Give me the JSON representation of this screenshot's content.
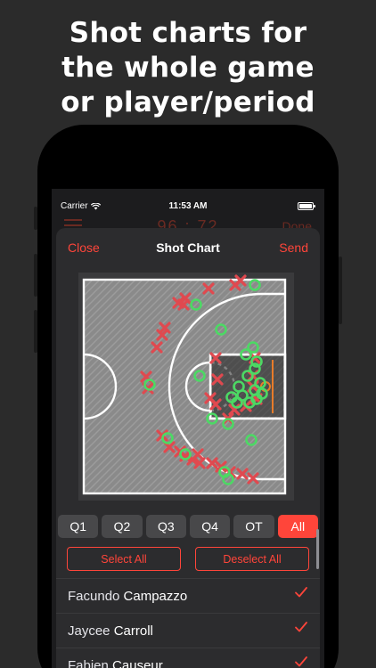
{
  "promo": {
    "line1": "Shot charts for",
    "line2": "the whole game",
    "line3": "or player/period"
  },
  "status_bar": {
    "carrier": "Carrier",
    "time": "11:53 AM"
  },
  "background_nav": {
    "score": "96 : 72",
    "done_label": "Done"
  },
  "sheet": {
    "close_label": "Close",
    "title": "Shot Chart",
    "send_label": "Send"
  },
  "colors": {
    "accent": "#ff453a",
    "made_shot": "#4cd964",
    "missed_shot": "#e0494f"
  },
  "periods": {
    "items": [
      "Q1",
      "Q2",
      "Q3",
      "Q4",
      "OT",
      "All"
    ],
    "selected": "All"
  },
  "selection": {
    "select_all_label": "Select All",
    "deselect_all_label": "Deselect All"
  },
  "players": [
    {
      "first": "Facundo",
      "last": "Campazzo",
      "checked": true
    },
    {
      "first": "Jaycee",
      "last": "Carroll",
      "checked": true
    },
    {
      "first": "Fabien",
      "last": "Causeur",
      "checked": true
    }
  ]
}
